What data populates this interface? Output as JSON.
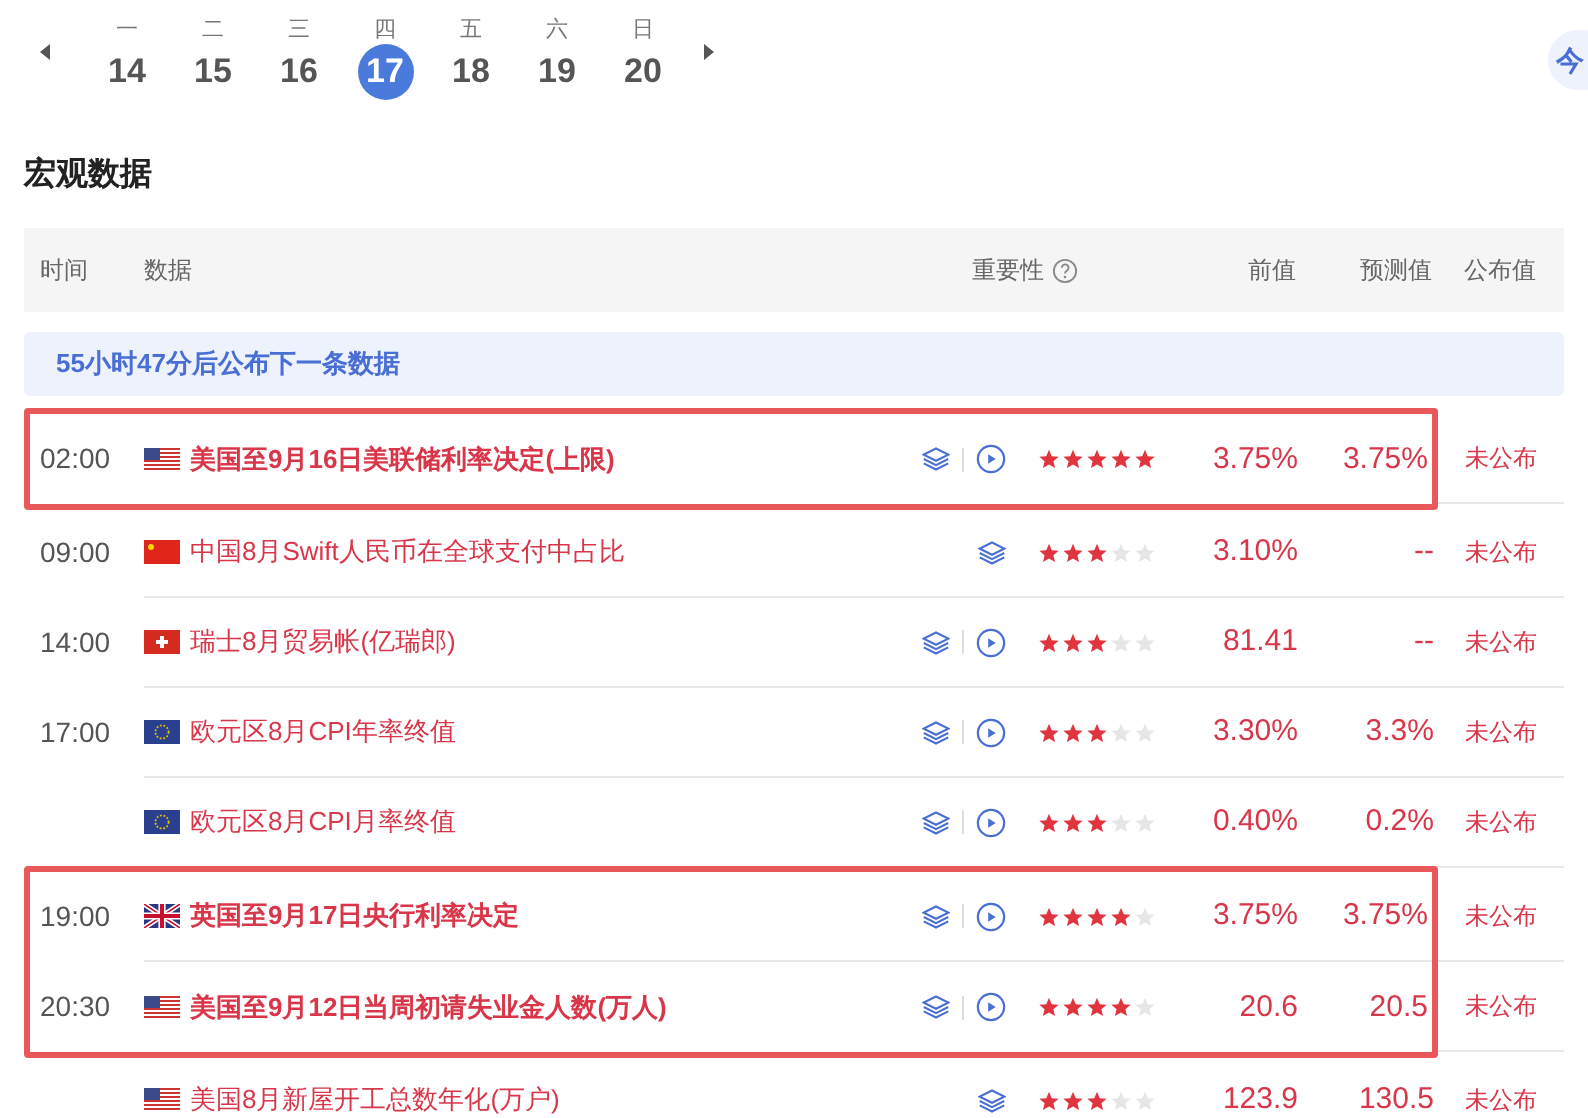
{
  "day_picker": {
    "days": [
      {
        "weekday": "一",
        "date": "14",
        "selected": false
      },
      {
        "weekday": "二",
        "date": "15",
        "selected": false
      },
      {
        "weekday": "三",
        "date": "16",
        "selected": false
      },
      {
        "weekday": "四",
        "date": "17",
        "selected": true
      },
      {
        "weekday": "五",
        "date": "18",
        "selected": false
      },
      {
        "weekday": "六",
        "date": "19",
        "selected": false
      },
      {
        "weekday": "日",
        "date": "20",
        "selected": false
      }
    ],
    "today_button": "今"
  },
  "section_title": "宏观数据",
  "table": {
    "columns": [
      "时间",
      "数据",
      "重要性",
      "前值",
      "预测值",
      "公布值"
    ],
    "banner": "55小时47分后公布下一条数据",
    "groups": [
      {
        "highlighted": true,
        "rows": [
          {
            "time": "02:00",
            "kind": "us",
            "name": "美国至9月16日美联储利率决定(上限)",
            "play": true,
            "stars": 5,
            "previous": "3.75%",
            "forecast": "3.75%",
            "actual": "未公布"
          }
        ]
      },
      {
        "highlighted": false,
        "rows": [
          {
            "time": "09:00",
            "kind": "cn",
            "name": "中国8月Swift人民币在全球支付中占比",
            "play": false,
            "stars": 3,
            "previous": "3.10%",
            "forecast": "--",
            "actual": "未公布"
          },
          {
            "time": "14:00",
            "kind": "ch",
            "name": "瑞士8月贸易帐(亿瑞郎)",
            "play": true,
            "stars": 3,
            "previous": "81.41",
            "forecast": "--",
            "actual": "未公布"
          },
          {
            "time": "17:00",
            "kind": "eu",
            "name": "欧元区8月CPI年率终值",
            "play": true,
            "stars": 3,
            "previous": "3.30%",
            "forecast": "3.3%",
            "actual": "未公布"
          },
          {
            "kind": "eu",
            "name": "欧元区8月CPI月率终值",
            "play": true,
            "stars": 3,
            "previous": "0.40%",
            "forecast": "0.2%",
            "actual": "未公布"
          }
        ]
      },
      {
        "highlighted": true,
        "rows": [
          {
            "time": "19:00",
            "kind": "gb",
            "name": "英国至9月17日央行利率决定",
            "play": true,
            "stars": 4,
            "previous": "3.75%",
            "forecast": "3.75%",
            "actual": "未公布"
          },
          {
            "time": "20:30",
            "kind": "us",
            "name": "美国至9月12日当周初请失业金人数(万人)",
            "play": true,
            "stars": 4,
            "previous": "20.6",
            "forecast": "20.5",
            "actual": "未公布"
          }
        ]
      },
      {
        "highlighted": false,
        "rows": [
          {
            "kind": "us",
            "name": "美国8月新屋开工总数年化(万户)",
            "play": false,
            "stars": 3,
            "previous": "123.9",
            "forecast": "130.5",
            "actual": "未公布"
          }
        ]
      }
    ]
  }
}
